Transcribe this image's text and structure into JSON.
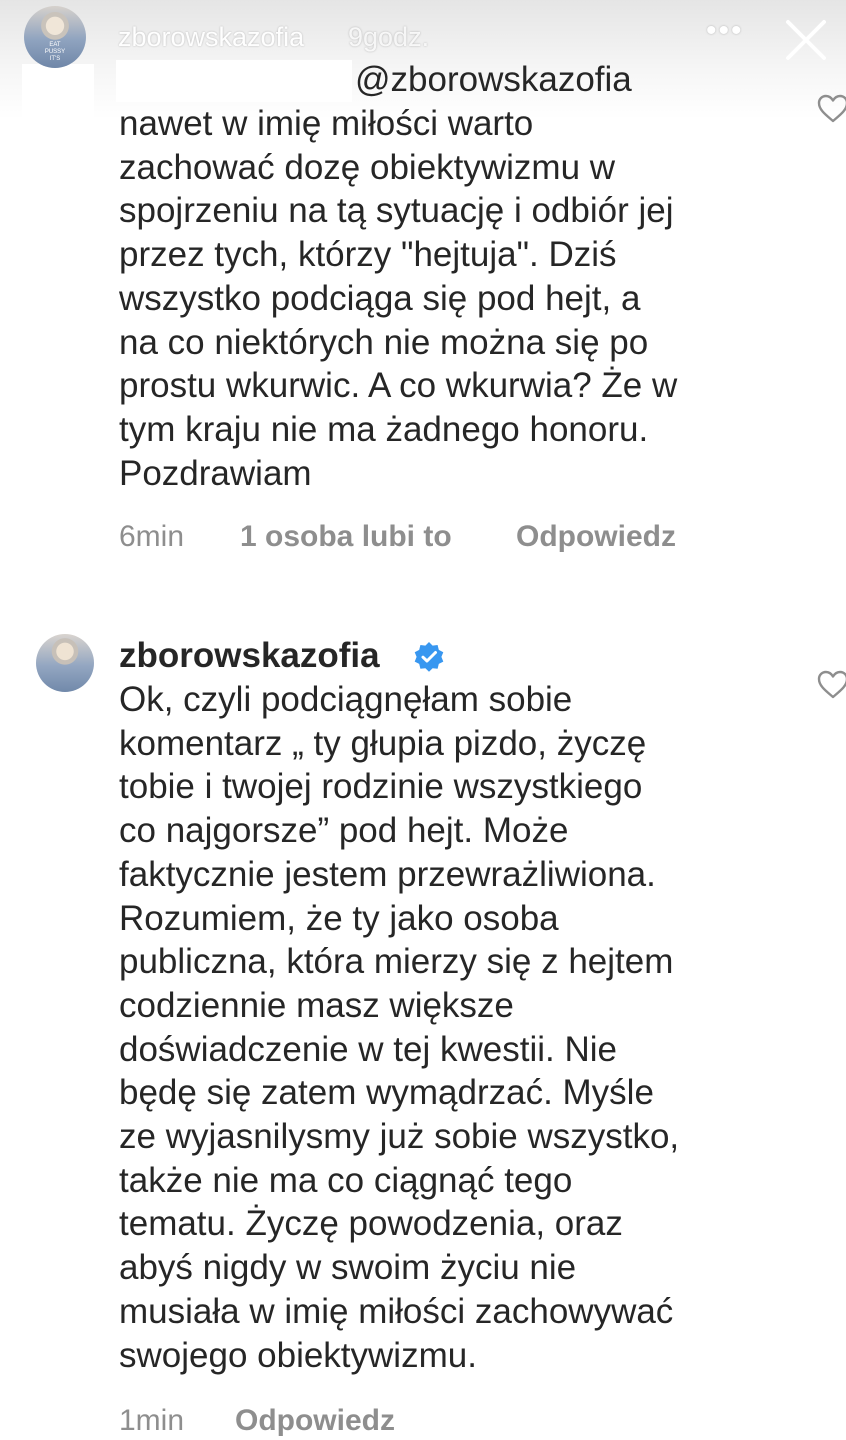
{
  "story": {
    "username": "zborowskazofia",
    "time": "9godz."
  },
  "comment1": {
    "mention": "@zborowskazofia",
    "lines": [
      "nawet w imię miłości warto",
      "zachować dozę obiektywizmu w",
      "spojrzeniu na tą sytuację i odbiór jej",
      "przez tych, którzy \"hejtuja\". Dziś",
      "wszystko podciąga się pod hejt, a",
      "na co niektórych nie można się po",
      "prostu wkurwic. A co wkurwia? Że w",
      "tym kraju nie ma żadnego honoru.",
      "Pozdrawiam"
    ],
    "time": "6min",
    "likes": "1 osoba lubi to",
    "reply": "Odpowiedz"
  },
  "comment2": {
    "username": "zborowskazofia",
    "lines": [
      "Ok, czyli podciągnęłam sobie",
      "komentarz „ ty głupia pizdo, życzę",
      "tobie i twojej rodzinie wszystkiego",
      "co najgorsze” pod hejt. Może",
      "faktycznie jestem przewrażliwiona.",
      "Rozumiem, że ty jako osoba",
      "publiczna, która mierzy się z hejtem",
      "codziennie masz większe",
      "doświadczenie w tej kwestii. Nie",
      "będę się zatem wymądrzać. Myśle",
      "ze wyjasnilysmy już sobie wszystko,",
      "także nie ma co ciągnąć tego",
      "tematu. Życzę powodzenia, oraz",
      "abyś nigdy w swoim życiu nie",
      "musiała w imię miłości zachowywać",
      "swojego obiektywizmu."
    ],
    "time": "1min",
    "reply": "Odpowiedz"
  },
  "icons": {
    "more": "more-options-icon",
    "close": "close-icon",
    "heart": "heart-icon",
    "verified": "verified-badge-icon"
  },
  "colors": {
    "text": "#262626",
    "meta": "#8e8e8e",
    "verified": "#3897f0"
  }
}
